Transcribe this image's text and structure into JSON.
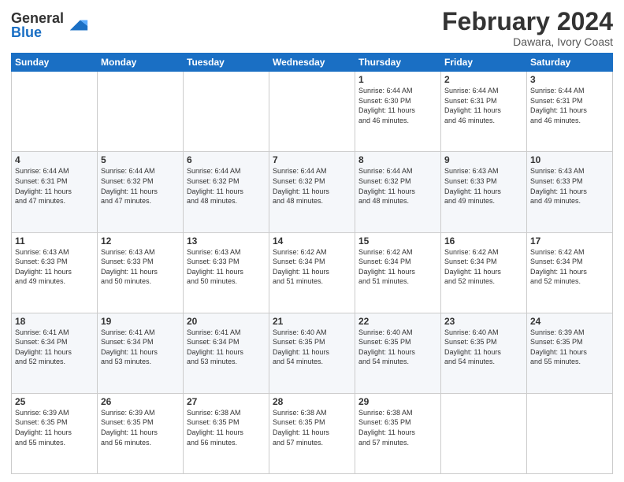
{
  "header": {
    "logo_general": "General",
    "logo_blue": "Blue",
    "month_title": "February 2024",
    "location": "Dawara, Ivory Coast"
  },
  "weekdays": [
    "Sunday",
    "Monday",
    "Tuesday",
    "Wednesday",
    "Thursday",
    "Friday",
    "Saturday"
  ],
  "weeks": [
    [
      {
        "day": "",
        "info": ""
      },
      {
        "day": "",
        "info": ""
      },
      {
        "day": "",
        "info": ""
      },
      {
        "day": "",
        "info": ""
      },
      {
        "day": "1",
        "info": "Sunrise: 6:44 AM\nSunset: 6:30 PM\nDaylight: 11 hours\nand 46 minutes."
      },
      {
        "day": "2",
        "info": "Sunrise: 6:44 AM\nSunset: 6:31 PM\nDaylight: 11 hours\nand 46 minutes."
      },
      {
        "day": "3",
        "info": "Sunrise: 6:44 AM\nSunset: 6:31 PM\nDaylight: 11 hours\nand 46 minutes."
      }
    ],
    [
      {
        "day": "4",
        "info": "Sunrise: 6:44 AM\nSunset: 6:31 PM\nDaylight: 11 hours\nand 47 minutes."
      },
      {
        "day": "5",
        "info": "Sunrise: 6:44 AM\nSunset: 6:32 PM\nDaylight: 11 hours\nand 47 minutes."
      },
      {
        "day": "6",
        "info": "Sunrise: 6:44 AM\nSunset: 6:32 PM\nDaylight: 11 hours\nand 48 minutes."
      },
      {
        "day": "7",
        "info": "Sunrise: 6:44 AM\nSunset: 6:32 PM\nDaylight: 11 hours\nand 48 minutes."
      },
      {
        "day": "8",
        "info": "Sunrise: 6:44 AM\nSunset: 6:32 PM\nDaylight: 11 hours\nand 48 minutes."
      },
      {
        "day": "9",
        "info": "Sunrise: 6:43 AM\nSunset: 6:33 PM\nDaylight: 11 hours\nand 49 minutes."
      },
      {
        "day": "10",
        "info": "Sunrise: 6:43 AM\nSunset: 6:33 PM\nDaylight: 11 hours\nand 49 minutes."
      }
    ],
    [
      {
        "day": "11",
        "info": "Sunrise: 6:43 AM\nSunset: 6:33 PM\nDaylight: 11 hours\nand 49 minutes."
      },
      {
        "day": "12",
        "info": "Sunrise: 6:43 AM\nSunset: 6:33 PM\nDaylight: 11 hours\nand 50 minutes."
      },
      {
        "day": "13",
        "info": "Sunrise: 6:43 AM\nSunset: 6:33 PM\nDaylight: 11 hours\nand 50 minutes."
      },
      {
        "day": "14",
        "info": "Sunrise: 6:42 AM\nSunset: 6:34 PM\nDaylight: 11 hours\nand 51 minutes."
      },
      {
        "day": "15",
        "info": "Sunrise: 6:42 AM\nSunset: 6:34 PM\nDaylight: 11 hours\nand 51 minutes."
      },
      {
        "day": "16",
        "info": "Sunrise: 6:42 AM\nSunset: 6:34 PM\nDaylight: 11 hours\nand 52 minutes."
      },
      {
        "day": "17",
        "info": "Sunrise: 6:42 AM\nSunset: 6:34 PM\nDaylight: 11 hours\nand 52 minutes."
      }
    ],
    [
      {
        "day": "18",
        "info": "Sunrise: 6:41 AM\nSunset: 6:34 PM\nDaylight: 11 hours\nand 52 minutes."
      },
      {
        "day": "19",
        "info": "Sunrise: 6:41 AM\nSunset: 6:34 PM\nDaylight: 11 hours\nand 53 minutes."
      },
      {
        "day": "20",
        "info": "Sunrise: 6:41 AM\nSunset: 6:34 PM\nDaylight: 11 hours\nand 53 minutes."
      },
      {
        "day": "21",
        "info": "Sunrise: 6:40 AM\nSunset: 6:35 PM\nDaylight: 11 hours\nand 54 minutes."
      },
      {
        "day": "22",
        "info": "Sunrise: 6:40 AM\nSunset: 6:35 PM\nDaylight: 11 hours\nand 54 minutes."
      },
      {
        "day": "23",
        "info": "Sunrise: 6:40 AM\nSunset: 6:35 PM\nDaylight: 11 hours\nand 54 minutes."
      },
      {
        "day": "24",
        "info": "Sunrise: 6:39 AM\nSunset: 6:35 PM\nDaylight: 11 hours\nand 55 minutes."
      }
    ],
    [
      {
        "day": "25",
        "info": "Sunrise: 6:39 AM\nSunset: 6:35 PM\nDaylight: 11 hours\nand 55 minutes."
      },
      {
        "day": "26",
        "info": "Sunrise: 6:39 AM\nSunset: 6:35 PM\nDaylight: 11 hours\nand 56 minutes."
      },
      {
        "day": "27",
        "info": "Sunrise: 6:38 AM\nSunset: 6:35 PM\nDaylight: 11 hours\nand 56 minutes."
      },
      {
        "day": "28",
        "info": "Sunrise: 6:38 AM\nSunset: 6:35 PM\nDaylight: 11 hours\nand 57 minutes."
      },
      {
        "day": "29",
        "info": "Sunrise: 6:38 AM\nSunset: 6:35 PM\nDaylight: 11 hours\nand 57 minutes."
      },
      {
        "day": "",
        "info": ""
      },
      {
        "day": "",
        "info": ""
      }
    ]
  ]
}
